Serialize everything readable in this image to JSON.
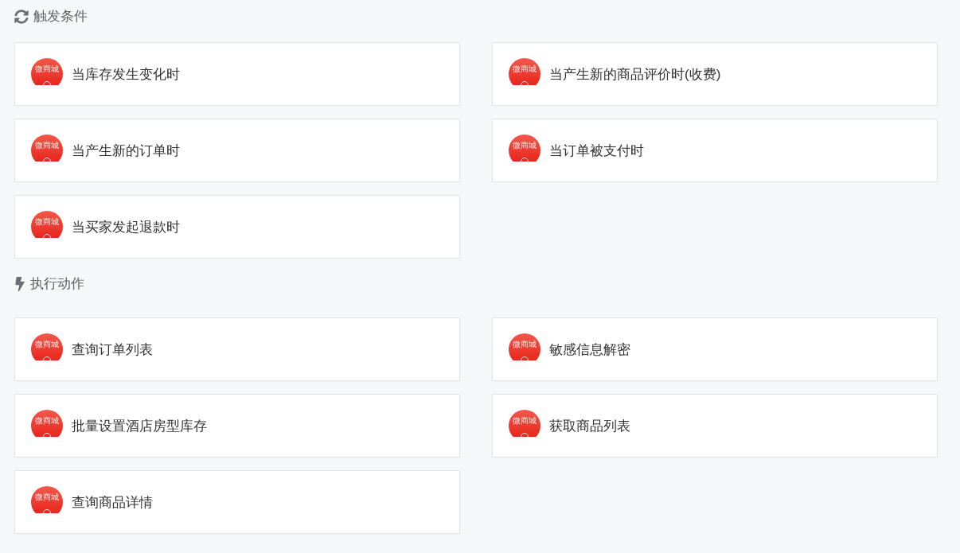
{
  "sections": [
    {
      "kind": "trigger",
      "title": "触发条件",
      "items": [
        {
          "label": "当库存发生变化时",
          "logo_text": "微商城"
        },
        {
          "label": "当产生新的商品评价时(收费)",
          "logo_text": "微商城"
        },
        {
          "label": "当产生新的订单时",
          "logo_text": "微商城"
        },
        {
          "label": "当订单被支付时",
          "logo_text": "微商城"
        },
        {
          "label": "当买家发起退款时",
          "logo_text": "微商城"
        }
      ]
    },
    {
      "kind": "action",
      "title": "执行动作",
      "items": [
        {
          "label": "查询订单列表",
          "logo_text": "微商城"
        },
        {
          "label": "敏感信息解密",
          "logo_text": "微商城"
        },
        {
          "label": "批量设置酒店房型库存",
          "logo_text": "微商城"
        },
        {
          "label": "获取商品列表",
          "logo_text": "微商城"
        },
        {
          "label": "查询商品详情",
          "logo_text": "微商城"
        }
      ]
    }
  ]
}
